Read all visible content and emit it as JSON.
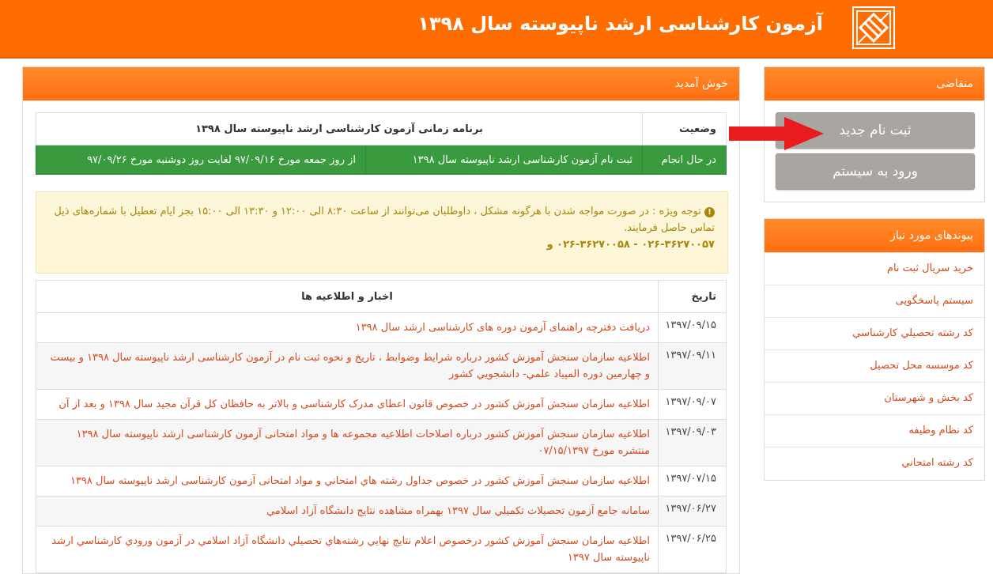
{
  "header": {
    "title": "آزمون کارشناسی ارشد ناپیوسته سال ۱۳۹۸",
    "bg_color": "#ff6d00"
  },
  "applicant_panel": {
    "title": "متقاضی",
    "register_label": "ثبت نام جدید",
    "login_label": "ورود به سیستم"
  },
  "links_panel": {
    "title": "پیوندهای مورد نیاز",
    "items": [
      "خرید سریال ثبت نام",
      "سیستم پاسخگویی",
      "کد رشته تحصیلي کارشناسي",
      "کد موسسه محل تحصيل",
      "کد بخش و شهرستان",
      "کد نظام وظيفه",
      "کد رشته امتحاني"
    ]
  },
  "main": {
    "welcome": "خوش آمدید",
    "schedule": {
      "status_header": "وضعیت",
      "title": "برنامه زمانی آزمون کارشناسی ارشد ناپیوسته سال ۱۳۹۸",
      "row": {
        "status": "در حال انجام",
        "event": "ثبت نام آزمون کارشناسی ارشد ناپیوسته سال ۱۳۹۸",
        "period": "از روز جمعه مورخ ۹۷/۰۹/۱۶ لغایت روز دوشنبه مورخ ۹۷/۰۹/۲۶"
      }
    },
    "notice": {
      "text": "توجه ویژه : در صورت مواجه شدن با هرگونه مشکل ، داوطلبان می‌توانند از ساعت ۸:۳۰ الی ۱۲:۰۰ و ۱۳:۳۰ الی ۱۵:۰۰ بجز ایام تعطیل با شماره‌های ذیل تماس حاصل فرمایند.",
      "phones": "۰۲۶-۳۶۲۷۰۰۵۷ - ۰۲۶-۳۶۲۷۰۰۵۸ و"
    },
    "news": {
      "date_header": "تاریخ",
      "title_header": "اخبار و اطلاعیه ها",
      "items": [
        {
          "date": "۱۳۹۷/۰۹/۱۵",
          "text": "دریافت دفترچه راهنمای آزمون دوره های کارشناسی ارشد سال ۱۳۹۸"
        },
        {
          "date": "۱۳۹۷/۰۹/۱۱",
          "text": "اطلاعیه سازمان سنجش آموزش کشور درباره شرایط وضوابط ، تاریخ و نحوه ثبت نام در آزمون کارشناسی ارشد ناپیوسته سال ۱۳۹۸ و بیست و چهارمین دوره المپیاد علمي- دانشجويي کشور"
        },
        {
          "date": "۱۳۹۷/۰۹/۰۷",
          "text": "اطلاعیه سازمان سنجش آموزش کشور در خصوص قانون اعطای مدرک کارشناسی و بالاتر به حافظان کل قرآن مجید سال ۱۳۹۸ و بعد از آن"
        },
        {
          "date": "۱۳۹۷/۰۹/۰۳",
          "text": "اطلاعیه سازمان سنجش آموزش کشور درباره اصلاحات اطلاعیه مجموعه ها و مواد امتحانی آزمون کارشناسی ارشد ناپیوسته سال ۱۳۹۸ منتشره مورخ ۰۷/۱۵/۱۳۹۷"
        },
        {
          "date": "۱۳۹۷/۰۷/۱۵",
          "text": "اطلاعیه سازمان سنجش آموزش کشور در خصوص جداول رشته هاي امتحاني و مواد امتحانی آزمون کارشناسی ارشد ناپیوسته سال ۱۳۹۸"
        },
        {
          "date": "۱۳۹۷/۰۶/۲۷",
          "text": "سامانه جامع آزمون تحصيلات تکميلي سال ۱۳۹۷ بهمراه مشاهده نتايج دانشگاه آزاد اسلامي"
        },
        {
          "date": "۱۳۹۷/۰۶/۲۵",
          "text": "اطلاعيه سازمان سنجش آموزش کشور درخصوص اعلام نتايج نهايي رشته‌هاي تحصيلي دانشگاه آزاد اسلامي در آزمون ورودي کارشناسي ارشد ناپيوسته سال ۱۳۹۷"
        }
      ]
    }
  }
}
